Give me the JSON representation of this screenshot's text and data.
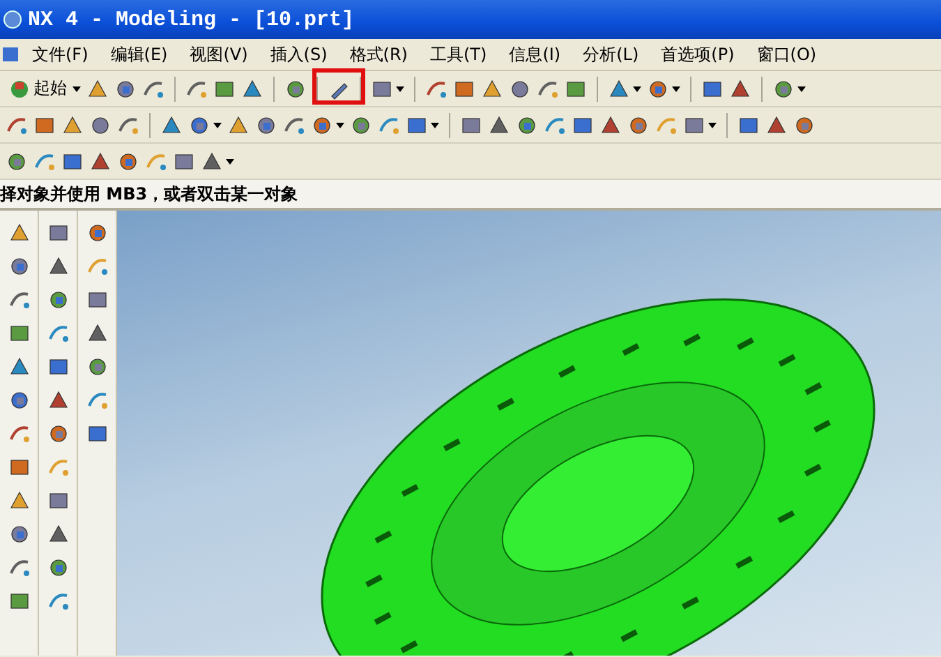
{
  "window": {
    "title": "NX 4 - Modeling - [10.prt]"
  },
  "menu": [
    "文件(F)",
    "编辑(E)",
    "视图(V)",
    "插入(S)",
    "格式(R)",
    "工具(T)",
    "信息(I)",
    "分析(L)",
    "首选项(P)",
    "窗口(O)"
  ],
  "toolbar": {
    "start_button": "起始"
  },
  "status_bar": {
    "prompt": "择对象并使用 MB3，或者双击某一对象"
  }
}
